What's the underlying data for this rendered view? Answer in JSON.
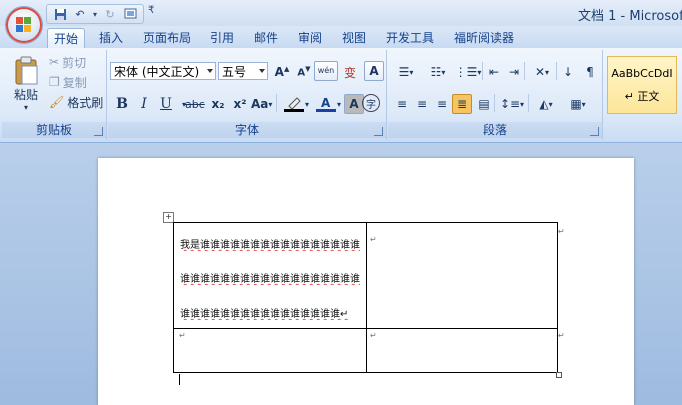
{
  "title": "文档 1 - Microsoft",
  "qat": {
    "more": "₹"
  },
  "tabs": [
    "开始",
    "插入",
    "页面布局",
    "引用",
    "邮件",
    "审阅",
    "视图",
    "开发工具",
    "福昕阅读器"
  ],
  "clipboard": {
    "label": "剪贴板",
    "paste": "粘贴",
    "cut": "剪切",
    "copy": "复制",
    "format_painter": "格式刷"
  },
  "font": {
    "label": "字体",
    "name": "宋体 (中文正文)",
    "size": "五号",
    "wen": "wén",
    "biao": "变",
    "A": "A",
    "bold": "B",
    "italic": "I",
    "underline": "U",
    "strike": "abc",
    "sub": "x₂",
    "sup": "x²",
    "aa": "Aa",
    "char_circle": "字"
  },
  "paragraph": {
    "label": "段落"
  },
  "styles": {
    "sample": "AaBbCcDdI",
    "name": "↵ 正文"
  },
  "document": {
    "lines": [
      "我是谁谁谁谁谁谁谁谁谁谁谁谁谁谁谁谁",
      "谁谁谁谁谁谁谁谁谁谁谁谁谁谁谁谁谁谁",
      "谁谁谁谁谁谁谁谁谁谁谁谁谁谁谁谁↵"
    ],
    "mark": "↵"
  }
}
